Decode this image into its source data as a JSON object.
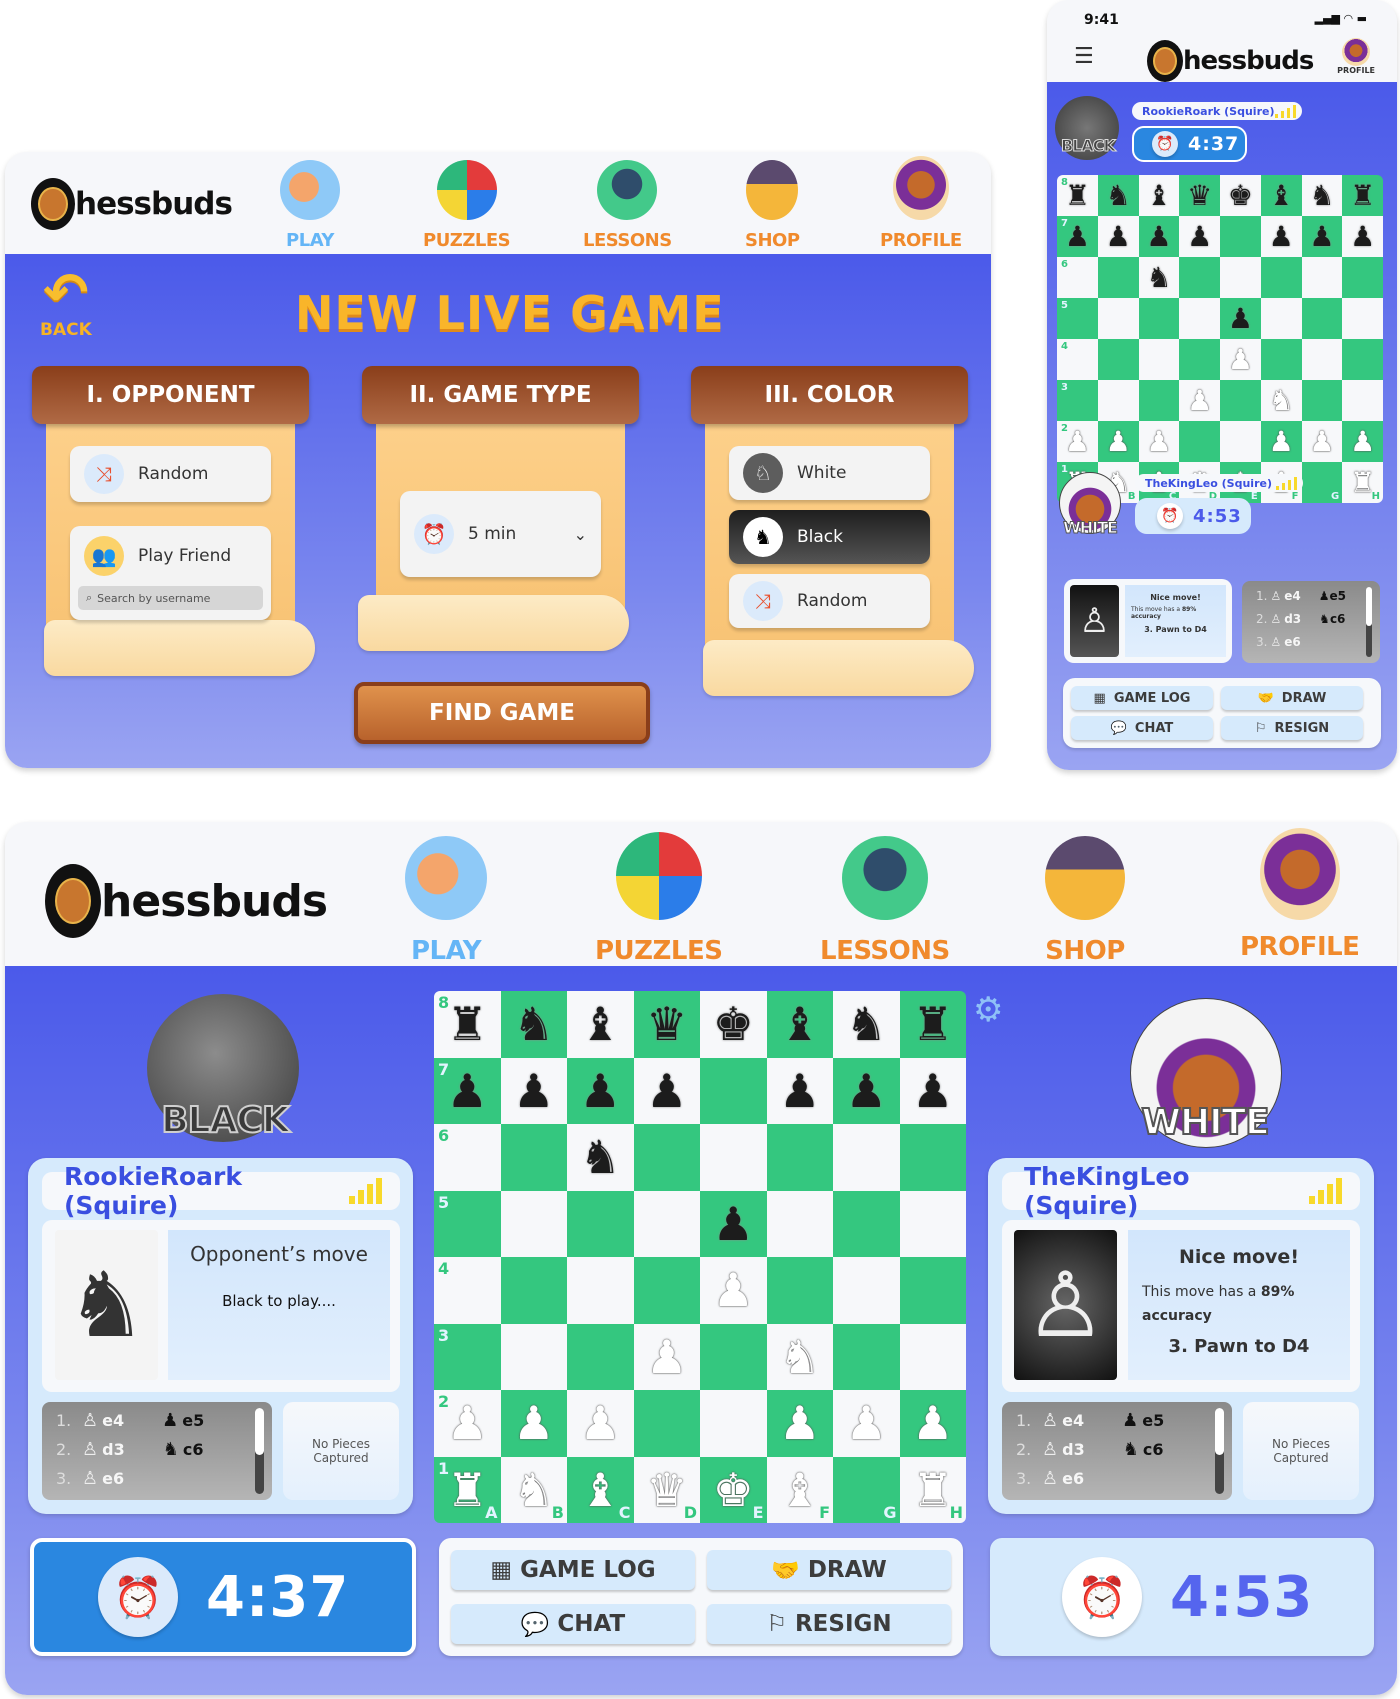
{
  "brand": {
    "name": "Chessbuds",
    "logo_initial": "C",
    "logo_rest": "hessbuds"
  },
  "nav": [
    {
      "label": "PLAY",
      "icon": "play-hand-icon"
    },
    {
      "label": "PUZZLES",
      "icon": "puzzle-icon"
    },
    {
      "label": "LESSONS",
      "icon": "graduation-cap-icon"
    },
    {
      "label": "SHOP",
      "icon": "shop-icon"
    },
    {
      "label": "PROFILE",
      "icon": "lion-king-icon"
    }
  ],
  "new_game": {
    "back_label": "BACK",
    "title": "NEW LIVE GAME",
    "sections": {
      "opponent": {
        "title": "I. OPPONENT",
        "options": [
          {
            "label": "Random",
            "icon": "shuffle-icon"
          },
          {
            "label": "Play Friend",
            "icon": "friends-icon"
          }
        ],
        "search_placeholder": "Search by username"
      },
      "game_type": {
        "title": "II. GAME TYPE",
        "selected": "5 min",
        "icon": "chess-clock-icon"
      },
      "color": {
        "title": "III. COLOR",
        "options": [
          {
            "label": "White",
            "icon": "white-knight-icon"
          },
          {
            "label": "Black",
            "icon": "black-knight-icon",
            "selected": true
          },
          {
            "label": "Random",
            "icon": "shuffle-icon"
          }
        ]
      }
    },
    "find_game_label": "FIND GAME"
  },
  "mobile": {
    "status_time": "9:41",
    "profile_label": "PROFILE"
  },
  "game": {
    "black_player": {
      "side_label": "BLACK",
      "name": "RookieRoark (Squire)",
      "signal_bars": 4,
      "clock": "4:37",
      "message_title": "Opponent’s move",
      "message_body": "Black to play....",
      "captured": "No Pieces Captured"
    },
    "white_player": {
      "side_label": "WHITE",
      "name": "TheKingLeo (Squire)",
      "signal_bars": 4,
      "clock": "4:53",
      "message_title": "Nice move!",
      "message_body_prefix": "This move has a ",
      "accuracy": "89%",
      "message_body_suffix": " accuracy",
      "last_move": "3. Pawn to D4",
      "captured": "No Pieces Captured"
    },
    "move_log": [
      {
        "num": "1.",
        "white": "e4",
        "black": "e5"
      },
      {
        "num": "2.",
        "white": "d3",
        "black": "c6"
      },
      {
        "num": "3.",
        "white": "e6",
        "black": ""
      }
    ],
    "move_log_piece_glyphs": {
      "white_pawn": "♙",
      "black_pawn": "♟",
      "black_knight": "♞"
    },
    "actions": [
      {
        "label": "GAME LOG",
        "icon": "checkerboard-icon"
      },
      {
        "label": "DRAW",
        "icon": "handshake-icon"
      },
      {
        "label": "CHAT",
        "icon": "chat-bubble-icon"
      },
      {
        "label": "RESIGN",
        "icon": "white-flag-icon"
      }
    ],
    "ranks": [
      "8",
      "7",
      "6",
      "5",
      "4",
      "3",
      "2",
      "1"
    ],
    "files": [
      "A",
      "B",
      "C",
      "D",
      "E",
      "F",
      "G",
      "H"
    ],
    "position": [
      [
        "r",
        "n",
        "b",
        "q",
        "k",
        "b",
        "n",
        "r"
      ],
      [
        "p",
        "p",
        "p",
        "p",
        "",
        "p",
        "p",
        "p"
      ],
      [
        "",
        "",
        "n",
        "",
        "",
        "",
        "",
        ""
      ],
      [
        "",
        "",
        "",
        "",
        "p",
        "",
        "",
        ""
      ],
      [
        "",
        "",
        "",
        "",
        "P",
        "",
        "",
        ""
      ],
      [
        "",
        "",
        "",
        "P",
        "",
        "N",
        "",
        ""
      ],
      [
        "P",
        "P",
        "P",
        "",
        "",
        "P",
        "P",
        "P"
      ],
      [
        "R",
        "N",
        "B",
        "Q",
        "K",
        "B",
        "",
        "R"
      ]
    ],
    "piece_glyphs": {
      "k": "♚",
      "q": "♛",
      "r": "♜",
      "b": "♝",
      "n": "♞",
      "p": "♟",
      "K": "♚",
      "Q": "♛",
      "R": "♜",
      "B": "♝",
      "N": "♞",
      "P": "♟"
    }
  },
  "colors": {
    "brand_blue": "#4b5aea",
    "board_dark": "#34c77f",
    "board_light": "#f7f8fa",
    "accent_orange": "#f08a2c",
    "title_gold": "#f9b52a",
    "clock_active": "#2a87e0",
    "signal_yellow": "#f8d92a"
  }
}
